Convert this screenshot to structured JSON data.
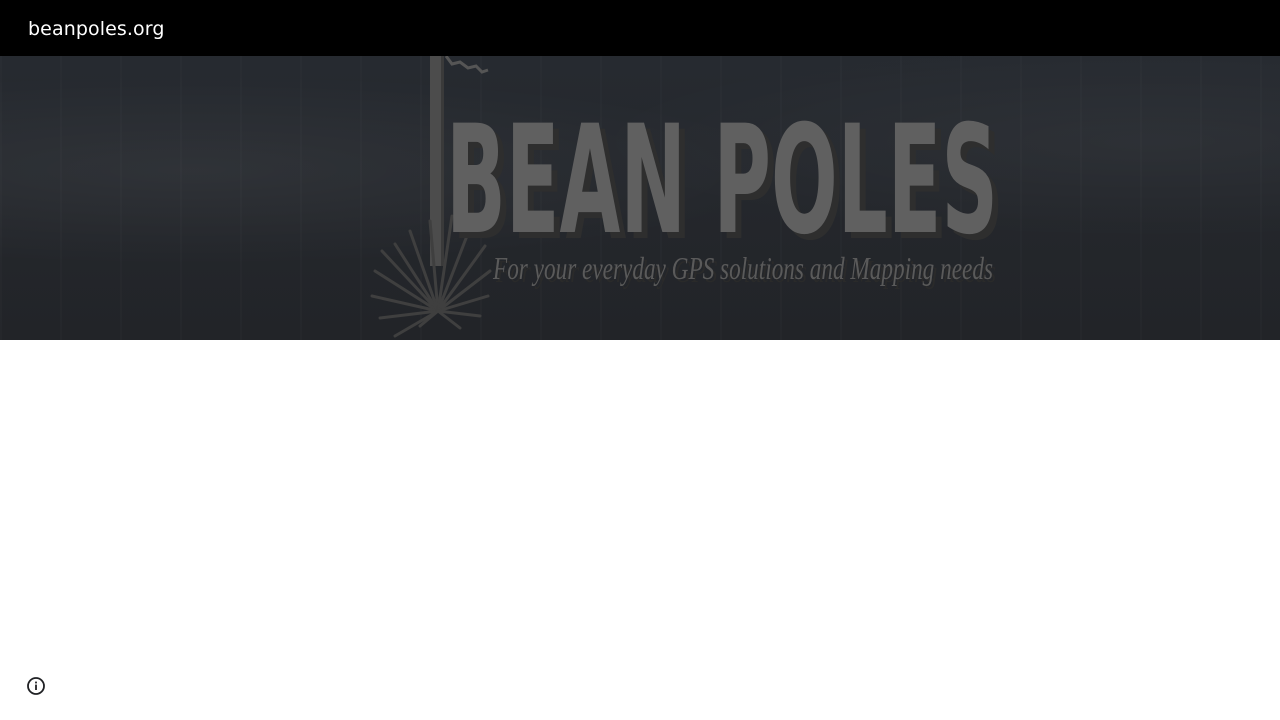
{
  "header": {
    "site_title": "beanpoles.org"
  },
  "hero": {
    "logo_title": "BEAN POLES",
    "logo_tagline": "For your everyday GPS solutions and Mapping needs"
  },
  "footer": {
    "info_icon": "info-icon"
  },
  "colors": {
    "header_bg": "#000000",
    "hero_bg": "#25282d",
    "logo_text": "#5f5f5f"
  }
}
